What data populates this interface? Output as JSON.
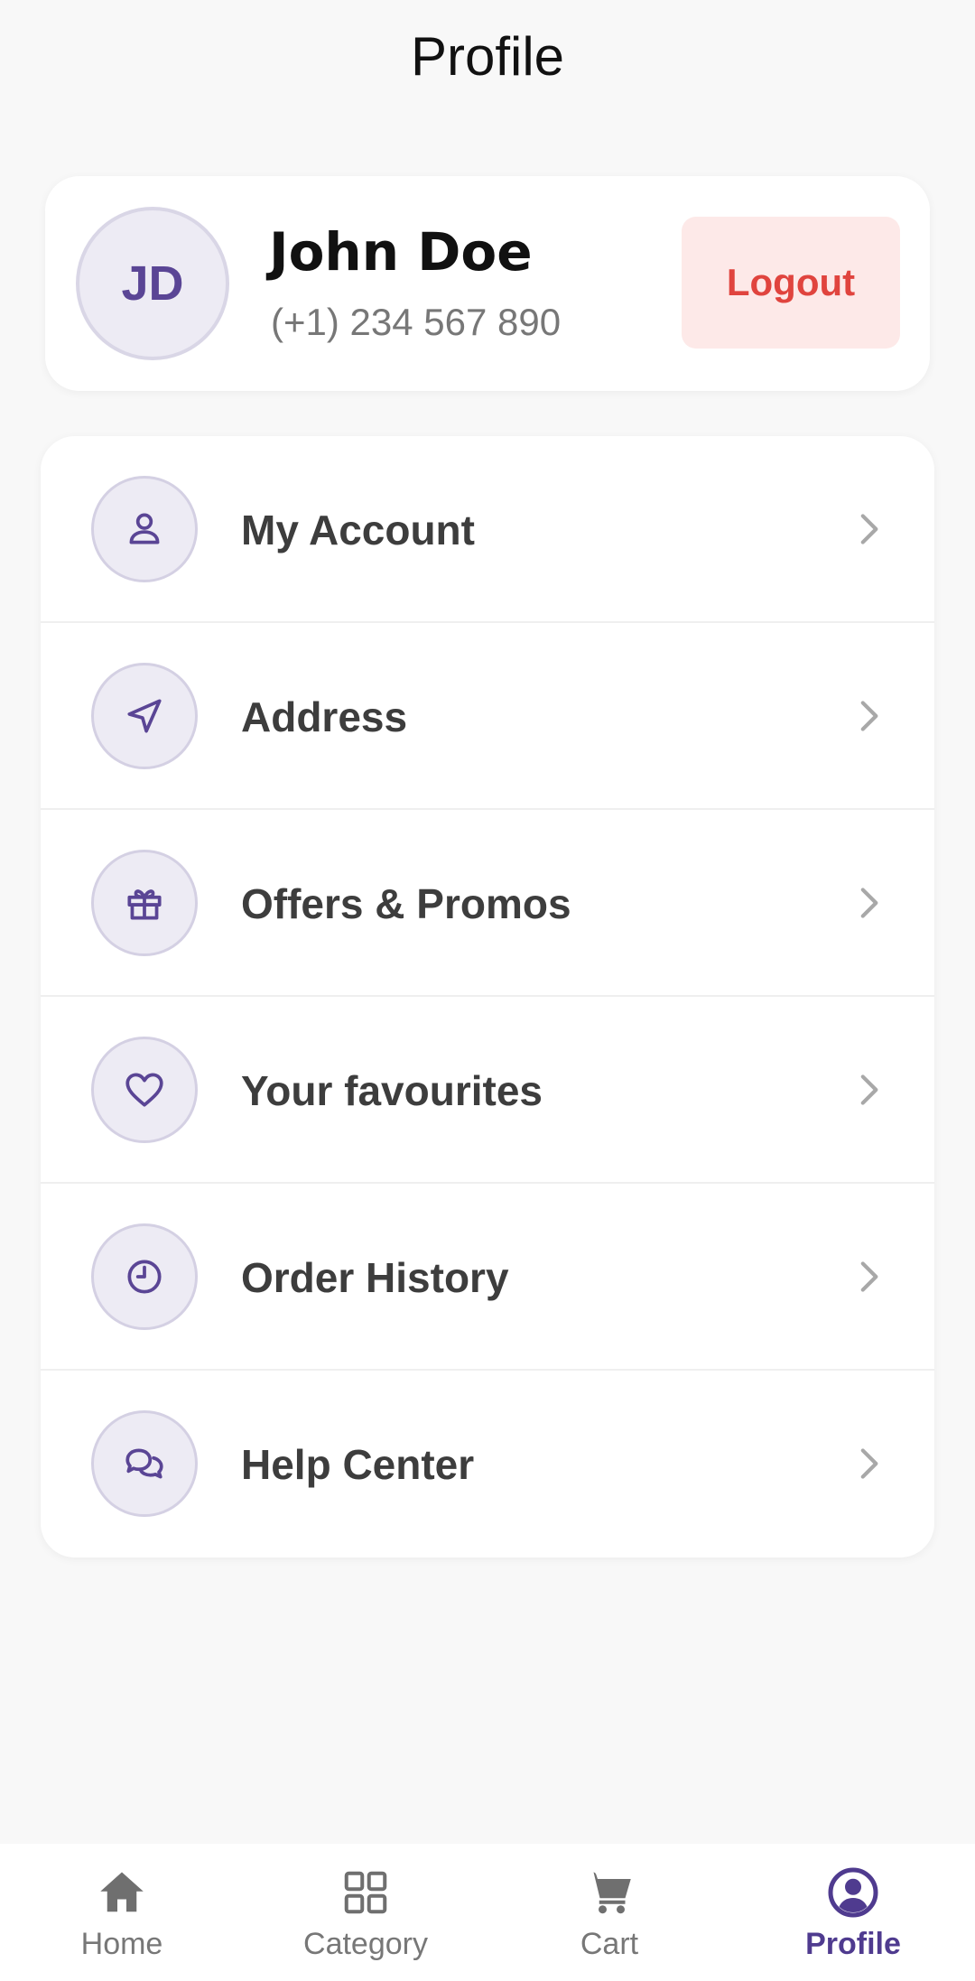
{
  "header": {
    "title": "Profile"
  },
  "profile": {
    "initials": "JD",
    "name": "John Doe",
    "phone": "(+1) 234 567 890",
    "logout_label": "Logout"
  },
  "menu": {
    "items": [
      {
        "label": "My Account",
        "icon": "user-icon"
      },
      {
        "label": "Address",
        "icon": "navigation-arrow-icon"
      },
      {
        "label": "Offers & Promos",
        "icon": "gift-icon"
      },
      {
        "label": "Your favourites",
        "icon": "heart-icon"
      },
      {
        "label": "Order History",
        "icon": "clock-icon"
      },
      {
        "label": "Help Center",
        "icon": "chat-bubbles-icon"
      }
    ]
  },
  "bottom_nav": {
    "items": [
      {
        "label": "Home",
        "icon": "home-icon",
        "active": false
      },
      {
        "label": "Category",
        "icon": "grid-icon",
        "active": false
      },
      {
        "label": "Cart",
        "icon": "cart-icon",
        "active": false
      },
      {
        "label": "Profile",
        "icon": "account-circle-icon",
        "active": true
      }
    ]
  },
  "colors": {
    "accent": "#5a4595",
    "logout_text": "#e0443e",
    "logout_bg": "#fde9e8",
    "background": "#f8f8f8"
  }
}
